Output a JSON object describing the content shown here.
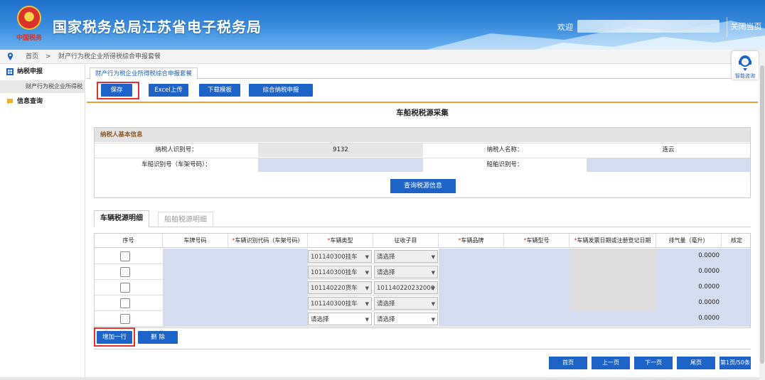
{
  "header": {
    "motto": "中国税务",
    "title": "国家税务总局江苏省电子税务局",
    "welcome": "欢迎",
    "close": "关闭当页"
  },
  "breadcrumb": {
    "home": "首页",
    "sep": ">",
    "current": "财产行为税企业所得税综合申报套餐"
  },
  "sidebar": {
    "items": [
      {
        "label": "纳税申报",
        "icon": "grid-icon"
      },
      {
        "label": "财产行为税企业所得税",
        "icon": ""
      },
      {
        "label": "信息查询",
        "icon": "chat-icon"
      }
    ]
  },
  "tab": {
    "label": "财产行为税企业所得税综合申报套餐"
  },
  "toolbar": {
    "save": "保存",
    "excel": "Excel上传",
    "download": "下载模板",
    "comprehensive": "综合纳税申报"
  },
  "section_title": "车船税税源采集",
  "taxpayer": {
    "heading": "纳税人基本信息",
    "id_label": "纳税人识别号：",
    "id_value": "9132",
    "name_label": "纳税人名称：",
    "name_value": "连云",
    "vin_label": "车船识别号（车架号码）：",
    "ship_label": "船舶识别号：",
    "query_button": "查询税源信息"
  },
  "subtabs": {
    "vehicle": "车辆税源明细",
    "ship": "船舶税源明细"
  },
  "grid": {
    "headers": [
      {
        "text": "序号",
        "req": ""
      },
      {
        "text": "车牌号码",
        "req": ""
      },
      {
        "text": "车辆识别代码（车架号码）",
        "req": "*"
      },
      {
        "text": "车辆类型",
        "req": "*"
      },
      {
        "text": "征收子目",
        "req": ""
      },
      {
        "text": "车辆品牌",
        "req": "*"
      },
      {
        "text": "车辆型号",
        "req": "*"
      },
      {
        "text": "车辆发票日期或注册登记日期",
        "req": "*"
      },
      {
        "text": "排气量（毫升）",
        "req": ""
      },
      {
        "text": "核定",
        "req": ""
      }
    ],
    "rows": [
      {
        "type": "101140300挂车",
        "sub": "请选择",
        "disp": "0.0000",
        "disabled": true
      },
      {
        "type": "101140300挂车",
        "sub": "请选择",
        "disp": "0.0000",
        "disabled": true
      },
      {
        "type": "101140220货车",
        "sub": "101140220232000",
        "disp": "0.0000",
        "disabled": true
      },
      {
        "type": "101140300挂车",
        "sub": "请选择",
        "disp": "0.0000",
        "disabled": true
      },
      {
        "type": "请选择",
        "sub": "请选择",
        "disp": "0.0000",
        "disabled": false
      }
    ]
  },
  "row_actions": {
    "add": "增加一行",
    "delete": "删 除"
  },
  "pager": {
    "first": "首页",
    "prev": "上一页",
    "next": "下一页",
    "last": "尾页",
    "info": "第1页/50条"
  },
  "assistant": {
    "label": "智能咨询"
  }
}
